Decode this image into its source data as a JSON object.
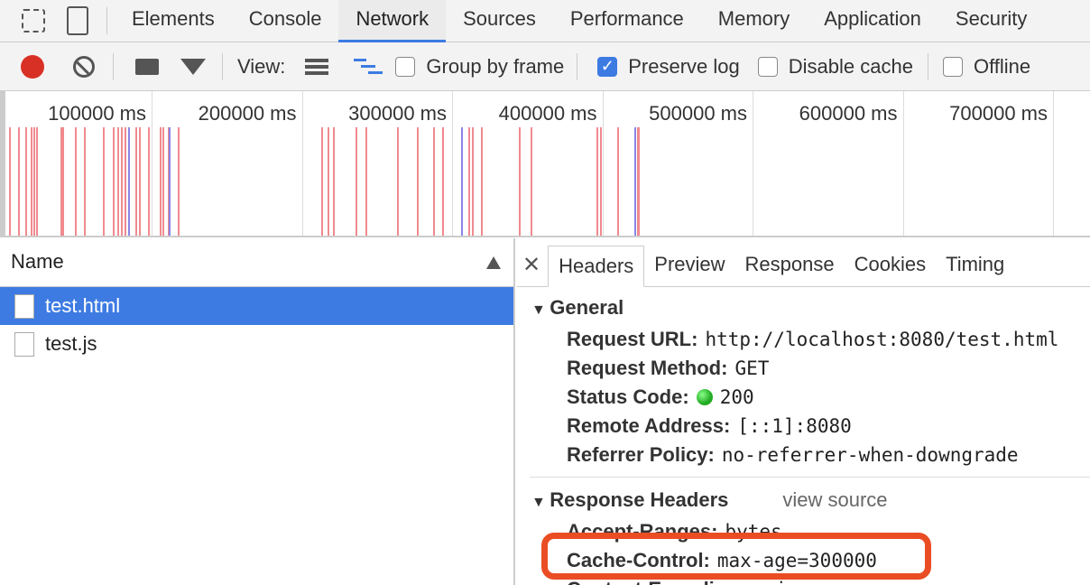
{
  "tabs": [
    "Elements",
    "Console",
    "Network",
    "Sources",
    "Performance",
    "Memory",
    "Application",
    "Security"
  ],
  "active_tab": "Network",
  "toolbar": {
    "view_label": "View:",
    "group_by_frame": "Group by frame",
    "preserve_log": "Preserve log",
    "disable_cache": "Disable cache",
    "offline": "Offline",
    "preserve_log_checked": true
  },
  "timeline": {
    "ticks": [
      "100000 ms",
      "200000 ms",
      "300000 ms",
      "400000 ms",
      "500000 ms",
      "600000 ms",
      "700000 ms"
    ]
  },
  "requests": {
    "column": "Name",
    "items": [
      "test.html",
      "test.js"
    ],
    "selected": "test.html"
  },
  "detail": {
    "tabs": [
      "Headers",
      "Preview",
      "Response",
      "Cookies",
      "Timing"
    ],
    "general": {
      "title": "General",
      "rows": [
        [
          "Request URL:",
          "http://localhost:8080/test.html"
        ],
        [
          "Request Method:",
          "GET"
        ],
        [
          "Status Code:",
          "200"
        ],
        [
          "Remote Address:",
          "[::1]:8080"
        ],
        [
          "Referrer Policy:",
          "no-referrer-when-downgrade"
        ]
      ]
    },
    "response": {
      "title": "Response Headers",
      "view_source": "view source",
      "rows": [
        [
          "Accept-Ranges:",
          "bytes"
        ],
        [
          "Cache-Control:",
          "max-age=300000"
        ],
        [
          "Content-Encoding:",
          "gzip"
        ]
      ]
    }
  },
  "colors": {
    "accent": "#3d7be3",
    "highlight": "#ea4d24",
    "record": "#d93025"
  }
}
